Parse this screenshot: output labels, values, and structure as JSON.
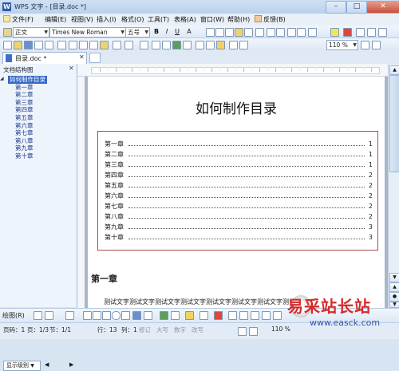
{
  "window": {
    "title": "WPS 文字 - [目录.doc *]"
  },
  "menu": {
    "items": [
      "文件(F)",
      "编辑(E)",
      "视图(V)",
      "插入(I)",
      "格式(O)",
      "工具(T)",
      "表格(A)",
      "窗口(W)",
      "帮助(H)",
      "反馈(B)"
    ]
  },
  "format_toolbar": {
    "style": "正文",
    "font": "Times New Roman",
    "size": "五号",
    "bold": "B",
    "italic": "I",
    "underline": "U",
    "font_color": "A"
  },
  "standard_toolbar": {
    "zoom": "110 %"
  },
  "tab": {
    "label": "目录.doc *"
  },
  "outline_pane": {
    "title": "文档结构图",
    "root": "如何制作目录",
    "items": [
      "第一章",
      "第二章",
      "第三章",
      "第四章",
      "第五章",
      "第六章",
      "第七章",
      "第八章",
      "第九章",
      "第十章"
    ],
    "level_button": "显示级别"
  },
  "document": {
    "title": "如何制作目录",
    "toc": [
      {
        "name": "第一章",
        "page": "1"
      },
      {
        "name": "第二章",
        "page": "1"
      },
      {
        "name": "第三章",
        "page": "1"
      },
      {
        "name": "第四章",
        "page": "2"
      },
      {
        "name": "第五章",
        "page": "2"
      },
      {
        "name": "第六章",
        "page": "2"
      },
      {
        "name": "第七章",
        "page": "2"
      },
      {
        "name": "第八章",
        "page": "2"
      },
      {
        "name": "第九章",
        "page": "3"
      },
      {
        "name": "第十章",
        "page": "3"
      }
    ],
    "chapter_heading": "第一章",
    "body_text": "测试文字测试文字测试文字测试文字测试文字测试文字测试文字测试文字"
  },
  "draw_toolbar": {
    "label": "绘图(R)"
  },
  "status": {
    "page_num": "页码：1",
    "page": "页：1/3",
    "section": "节：1/1",
    "row": "行：13",
    "col": "列：1",
    "rev": "修订",
    "caps": "大写",
    "num": "数字",
    "overwrite": "改写",
    "zoom": "110 %"
  },
  "watermark": {
    "big": "易采站长站",
    "small": "www.easck.com"
  }
}
